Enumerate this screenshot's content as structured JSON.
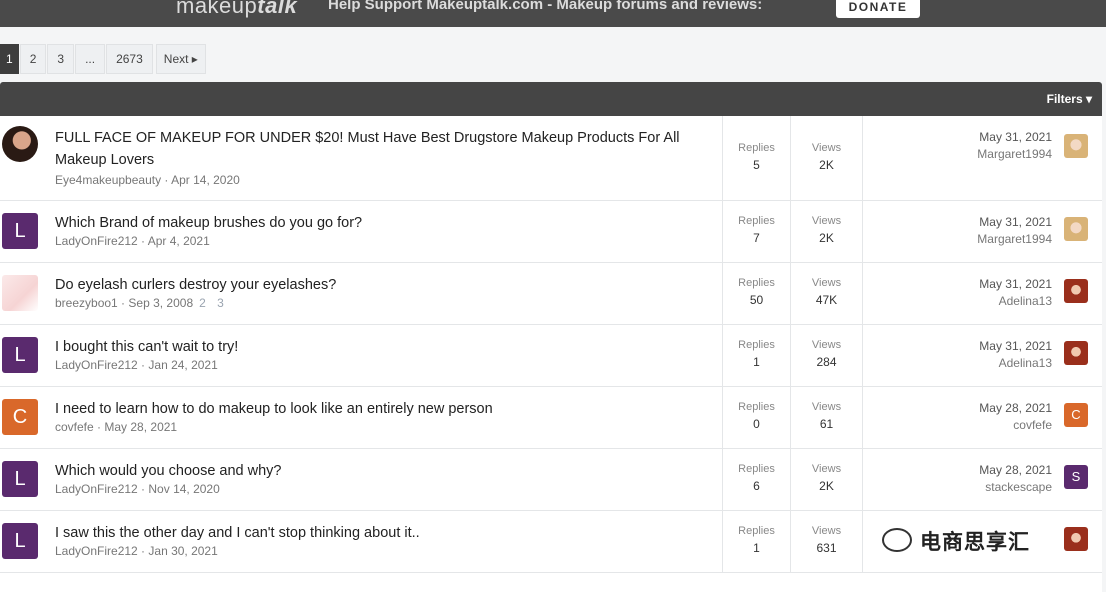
{
  "banner": {
    "logo_prefix": "makeup",
    "logo_suffix": "talk",
    "tagline": "Help Support Makeuptalk.com - Makeup forums and reviews:",
    "donate_label": "DONATE"
  },
  "pagination": {
    "pages": [
      "1",
      "2",
      "3",
      "...",
      "2673"
    ],
    "current": "1",
    "next_label": "Next ▸"
  },
  "filters_label": "Filters ▾",
  "colors": {
    "purple_avatar": "#5a2a6e",
    "orange_avatar": "#d9682a",
    "header_bar": "#454545"
  },
  "threads": [
    {
      "title": "FULL FACE OF MAKEUP FOR UNDER $20! Must Have Best Drugstore Makeup Products For All Makeup Lovers",
      "author": "Eye4makeupbeauty",
      "date": "Apr 14, 2020",
      "avatar": "photo",
      "replies_label": "Replies",
      "replies": "5",
      "views_label": "Views",
      "views": "2K",
      "last_date": "May 31, 2021",
      "last_user": "Margaret1994",
      "last_avatar": "photo-blonde"
    },
    {
      "title": "Which Brand of makeup brushes do you go for?",
      "author": "LadyOnFire212",
      "date": "Apr 4, 2021",
      "avatar": "L",
      "replies_label": "Replies",
      "replies": "7",
      "views_label": "Views",
      "views": "2K",
      "last_date": "May 31, 2021",
      "last_user": "Margaret1994",
      "last_avatar": "photo-blonde"
    },
    {
      "title": "Do eyelash curlers destroy your eyelashes?",
      "author": "breezyboo1",
      "date": "Sep 3, 2008",
      "pages": "2 3",
      "avatar": "photo-light",
      "replies_label": "Replies",
      "replies": "50",
      "views_label": "Views",
      "views": "47K",
      "last_date": "May 31, 2021",
      "last_user": "Adelina13",
      "last_avatar": "photo-red"
    },
    {
      "title": "I bought this can't wait to try!",
      "author": "LadyOnFire212",
      "date": "Jan 24, 2021",
      "avatar": "L",
      "replies_label": "Replies",
      "replies": "1",
      "views_label": "Views",
      "views": "284",
      "last_date": "May 31, 2021",
      "last_user": "Adelina13",
      "last_avatar": "photo-red"
    },
    {
      "title": "I need to learn how to do makeup to look like an entirely new person",
      "author": "covfefe",
      "date": "May 28, 2021",
      "avatar": "C",
      "replies_label": "Replies",
      "replies": "0",
      "views_label": "Views",
      "views": "61",
      "last_date": "May 28, 2021",
      "last_user": "covfefe",
      "last_avatar": "C"
    },
    {
      "title": "Which would you choose and why?",
      "author": "LadyOnFire212",
      "date": "Nov 14, 2020",
      "avatar": "L",
      "replies_label": "Replies",
      "replies": "6",
      "views_label": "Views",
      "views": "2K",
      "last_date": "May 28, 2021",
      "last_user": "stackescape",
      "last_avatar": "S"
    },
    {
      "title": "I saw this the other day and I can't stop thinking about it..",
      "author": "LadyOnFire212",
      "date": "Jan 30, 2021",
      "avatar": "L",
      "replies_label": "Replies",
      "replies": "1",
      "views_label": "Views",
      "views": "631",
      "last_date": "",
      "last_user": "",
      "last_avatar": "photo-red"
    }
  ],
  "watermark": "电商思享汇"
}
